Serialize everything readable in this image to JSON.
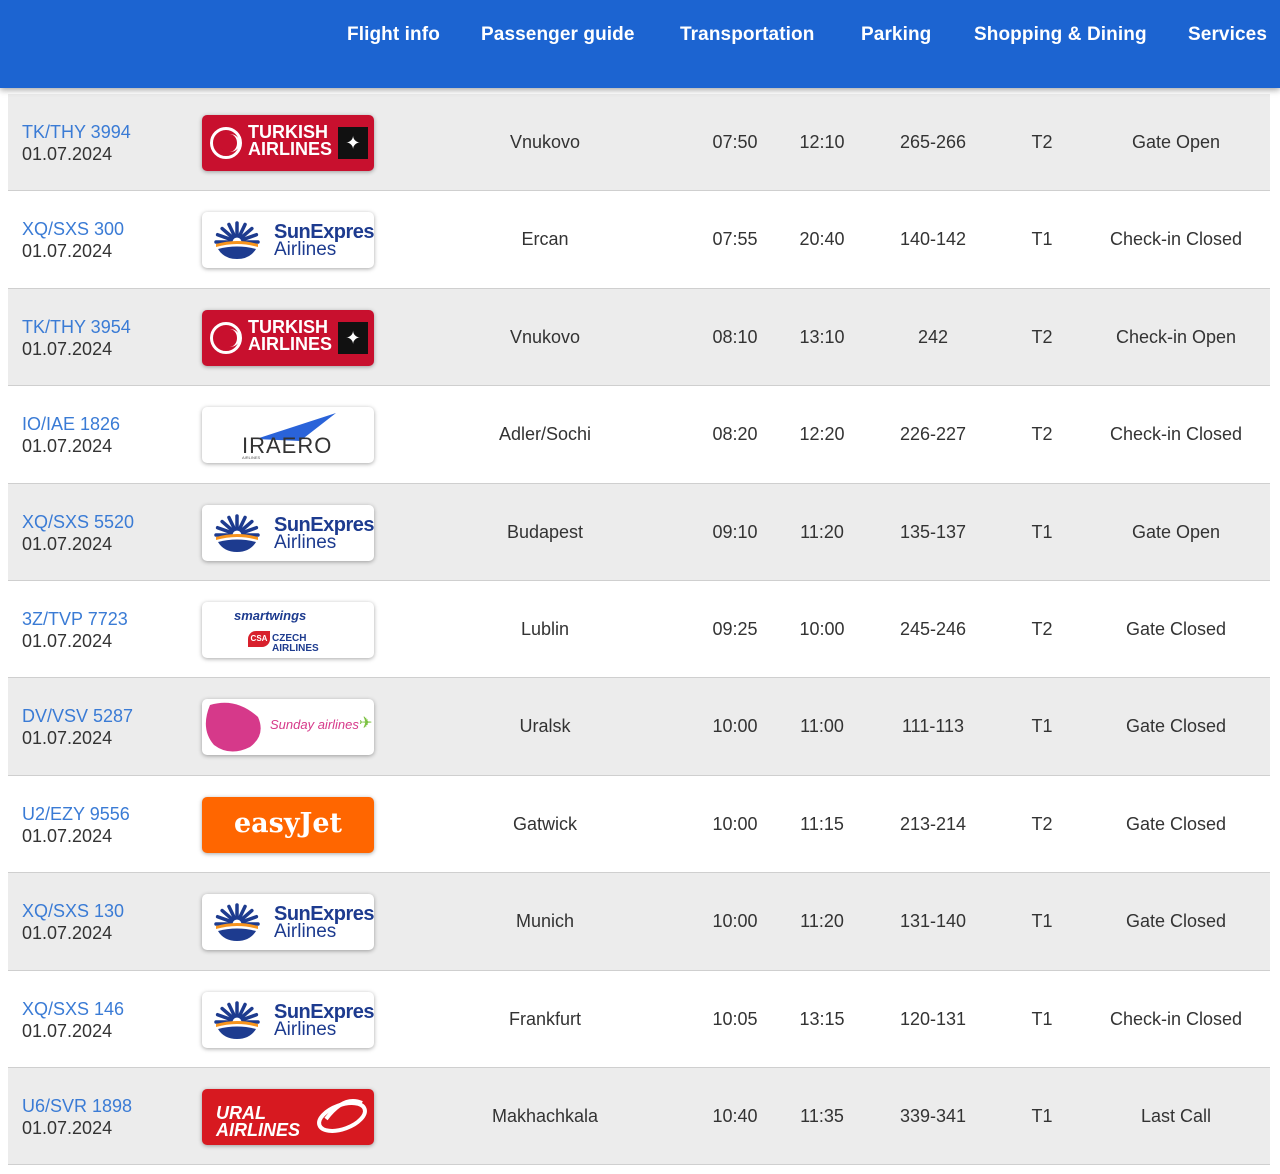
{
  "nav": {
    "items": [
      {
        "label": "Flight info"
      },
      {
        "label": "Passenger guide"
      },
      {
        "label": "Transportation"
      },
      {
        "label": "Parking"
      },
      {
        "label": "Shopping & Dining"
      },
      {
        "label": "Services"
      }
    ]
  },
  "flights": [
    {
      "flight": "TK/THY 3994",
      "date": "01.07.2024",
      "airline": "turkish",
      "logo_text": [
        "TURKISH",
        "AIRLINES"
      ],
      "destination": "Vnukovo",
      "departure": "07:50",
      "arrival": "12:10",
      "counters": "265-266",
      "terminal": "T2",
      "status": "Gate Open"
    },
    {
      "flight": "XQ/SXS 300",
      "date": "01.07.2024",
      "airline": "sunexpress",
      "logo_text": [
        "SunExpress",
        "Airlines"
      ],
      "destination": "Ercan",
      "departure": "07:55",
      "arrival": "20:40",
      "counters": "140-142",
      "terminal": "T1",
      "status": "Check-in Closed"
    },
    {
      "flight": "TK/THY 3954",
      "date": "01.07.2024",
      "airline": "turkish",
      "logo_text": [
        "TURKISH",
        "AIRLINES"
      ],
      "destination": "Vnukovo",
      "departure": "08:10",
      "arrival": "13:10",
      "counters": "242",
      "terminal": "T2",
      "status": "Check-in Open"
    },
    {
      "flight": "IO/IAE 1826",
      "date": "01.07.2024",
      "airline": "iraero",
      "logo_text": [
        "IRAERO",
        "AIRLINES"
      ],
      "destination": "Adler/Sochi",
      "departure": "08:20",
      "arrival": "12:20",
      "counters": "226-227",
      "terminal": "T2",
      "status": "Check-in Closed"
    },
    {
      "flight": "XQ/SXS 5520",
      "date": "01.07.2024",
      "airline": "sunexpress",
      "logo_text": [
        "SunExpress",
        "Airlines"
      ],
      "destination": "Budapest",
      "departure": "09:10",
      "arrival": "11:20",
      "counters": "135-137",
      "terminal": "T1",
      "status": "Gate Open"
    },
    {
      "flight": "3Z/TVP 7723",
      "date": "01.07.2024",
      "airline": "smartwings",
      "logo_text": [
        "smartwings",
        "CZECH AIRLINES"
      ],
      "destination": "Lublin",
      "departure": "09:25",
      "arrival": "10:00",
      "counters": "245-246",
      "terminal": "T2",
      "status": "Gate Closed"
    },
    {
      "flight": "DV/VSV 5287",
      "date": "01.07.2024",
      "airline": "sunday",
      "logo_text": [
        "Sunday airlines"
      ],
      "destination": "Uralsk",
      "departure": "10:00",
      "arrival": "11:00",
      "counters": "111-113",
      "terminal": "T1",
      "status": "Gate Closed"
    },
    {
      "flight": "U2/EZY 9556",
      "date": "01.07.2024",
      "airline": "easyjet",
      "logo_text": [
        "easyJet"
      ],
      "destination": "Gatwick",
      "departure": "10:00",
      "arrival": "11:15",
      "counters": "213-214",
      "terminal": "T2",
      "status": "Gate Closed"
    },
    {
      "flight": "XQ/SXS 130",
      "date": "01.07.2024",
      "airline": "sunexpress",
      "logo_text": [
        "SunExpress",
        "Airlines"
      ],
      "destination": "Munich",
      "departure": "10:00",
      "arrival": "11:20",
      "counters": "131-140",
      "terminal": "T1",
      "status": "Gate Closed"
    },
    {
      "flight": "XQ/SXS 146",
      "date": "01.07.2024",
      "airline": "sunexpress",
      "logo_text": [
        "SunExpress",
        "Airlines"
      ],
      "destination": "Frankfurt",
      "departure": "10:05",
      "arrival": "13:15",
      "counters": "120-131",
      "terminal": "T1",
      "status": "Check-in Closed"
    },
    {
      "flight": "U6/SVR 1898",
      "date": "01.07.2024",
      "airline": "ural",
      "logo_text": [
        "URAL",
        "AIRLINES"
      ],
      "destination": "Makhachkala",
      "departure": "10:40",
      "arrival": "11:35",
      "counters": "339-341",
      "terminal": "T1",
      "status": "Last Call"
    }
  ],
  "colors": {
    "header_bg": "#1c64d1",
    "flight_link": "#3a7bd5",
    "row_alt": "#ececec"
  }
}
